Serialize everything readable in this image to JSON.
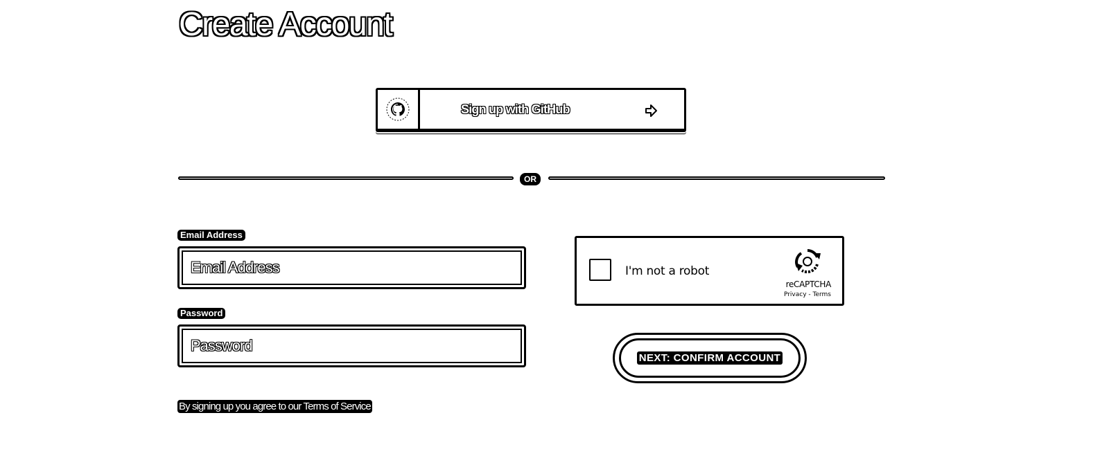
{
  "page": {
    "title": "Create Account"
  },
  "github_button": {
    "label": "Sign up with GitHub",
    "icon": "github-icon",
    "arrow_icon": "arrow-right-circle-icon"
  },
  "divider": {
    "label": "OR"
  },
  "form": {
    "email": {
      "label": "Email Address",
      "placeholder": "Email Address",
      "value": ""
    },
    "password": {
      "label": "Password",
      "placeholder": "Password",
      "value": ""
    }
  },
  "recaptcha": {
    "checkbox_label": "I'm not a robot",
    "brand": "reCAPTCHA",
    "links": "Privacy - Terms",
    "checked": false
  },
  "next_button": {
    "label": "NEXT: CONFIRM ACCOUNT"
  },
  "terms": {
    "prefix": "By signing up you agree to our ",
    "link": "Terms of Service"
  }
}
